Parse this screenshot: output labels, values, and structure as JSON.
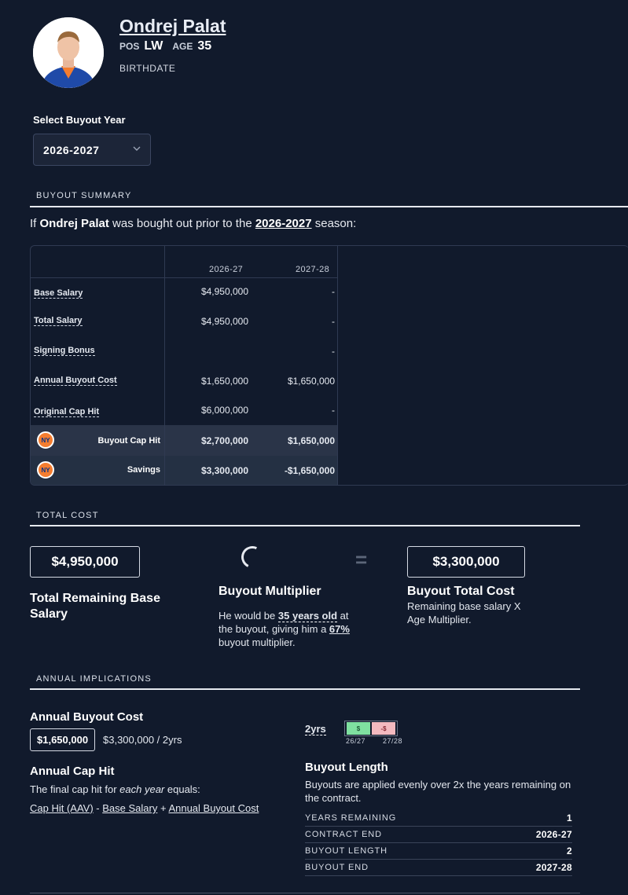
{
  "player": {
    "name": "Ondrej Palat",
    "pos_label": "POS",
    "pos": "LW",
    "age_label": "AGE",
    "age": "35",
    "birthdate_label": "BIRTHDATE"
  },
  "select": {
    "label": "Select Buyout Year",
    "value": "2026-2027"
  },
  "summary": {
    "heading": "BUYOUT SUMMARY",
    "intro_prefix": "If ",
    "intro_name": "Ondrej Palat",
    "intro_mid": " was bought out prior to the ",
    "intro_year": "2026-2027",
    "intro_suffix": " season:",
    "columns": [
      "2026-27",
      "2027-28"
    ],
    "rows": [
      {
        "label": "Base Salary",
        "values": [
          "$4,950,000",
          "-"
        ]
      },
      {
        "label": "Total Salary",
        "values": [
          "$4,950,000",
          "-"
        ]
      },
      {
        "label": "Signing Bonus",
        "values": [
          "",
          "-"
        ]
      },
      {
        "label": "Annual Buyout Cost",
        "values": [
          "$1,650,000",
          "$1,650,000"
        ]
      },
      {
        "label": "Original Cap Hit",
        "values": [
          "$6,000,000",
          "-"
        ]
      }
    ],
    "bottom_rows": [
      {
        "label": "Buyout Cap Hit",
        "logo": "NY",
        "values": [
          "$2,700,000",
          "$1,650,000"
        ]
      },
      {
        "label": "Savings",
        "logo": "NY",
        "values": [
          "$3,300,000",
          "-$1,650,000"
        ]
      }
    ]
  },
  "total_cost": {
    "heading": "TOTAL COST",
    "remaining_value": "$4,950,000",
    "remaining_title": "Total Remaining Base Salary",
    "multiplier_title": "Buyout Multiplier",
    "multiplier_text_1": "He would be ",
    "multiplier_age": "35 years old",
    "multiplier_text_2": " at the buyout, giving him a ",
    "multiplier_pct": "67%",
    "multiplier_text_3": " buyout multiplier.",
    "total_value": "$3,300,000",
    "total_title": "Buyout Total Cost",
    "total_text": "Remaining base salary X Age Multiplier."
  },
  "annual": {
    "heading": "ANNUAL IMPLICATIONS",
    "cost_title": "Annual Buyout Cost",
    "cost_value": "$1,650,000",
    "cost_detail": "$3,300,000 / 2yrs",
    "caphit_title": "Annual Cap Hit",
    "caphit_text_1": "The final cap hit for ",
    "caphit_text_em": "each year",
    "caphit_text_2": " equals:",
    "formula_a": "Cap Hit (AAV)",
    "formula_op1": " - ",
    "formula_b": "Base Salary",
    "formula_op2": " + ",
    "formula_c": "Annual Buyout Cost",
    "years_label": "2yrs",
    "bar1": "$",
    "bar2": "-$",
    "bar1_year": "26/27",
    "bar2_year": "27/28",
    "length_title": "Buyout Length",
    "length_text": "Buyouts are applied evenly over 2x the years remaining on the contract.",
    "stats": [
      {
        "label": "YEARS REMAINING",
        "value": "1"
      },
      {
        "label": "CONTRACT END",
        "value": "2026-27"
      },
      {
        "label": "BUYOUT LENGTH",
        "value": "2"
      },
      {
        "label": "BUYOUT END",
        "value": "2027-28"
      }
    ]
  },
  "colors": {
    "background": "#111a2c",
    "positive_bar": "#7fe0a0",
    "negative_bar": "#f3b9bf",
    "team_orange": "#f47d30",
    "team_blue": "#003087"
  }
}
